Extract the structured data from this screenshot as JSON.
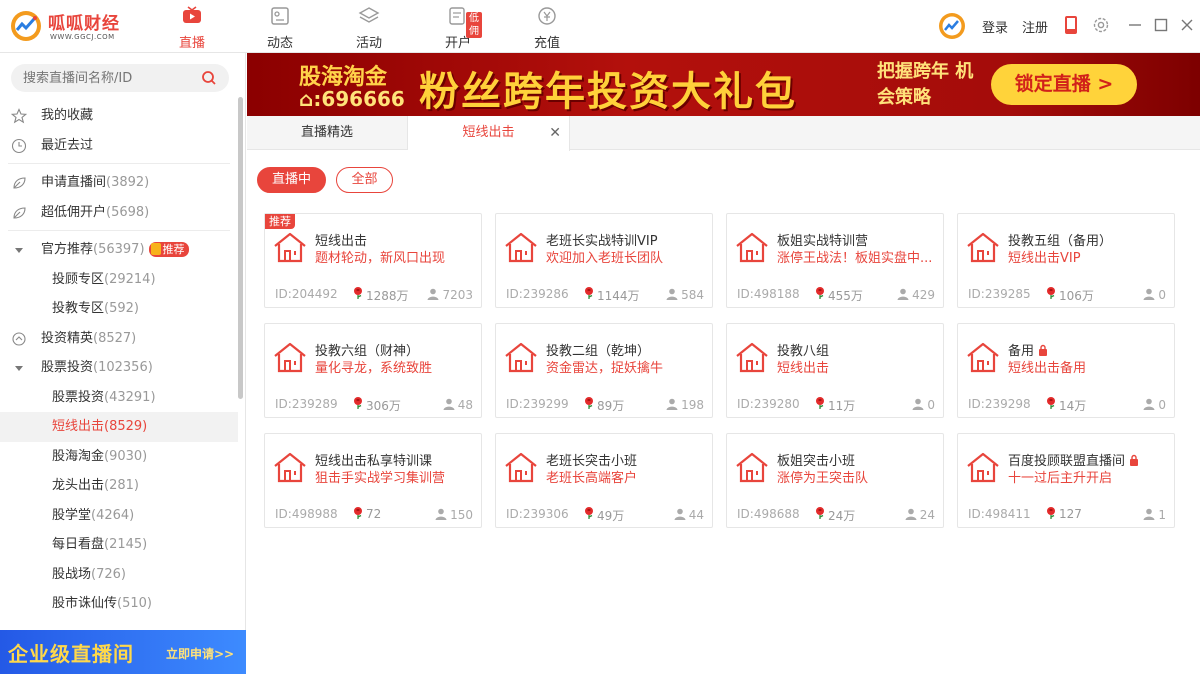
{
  "app": {
    "name": "呱呱财经",
    "url": "WWW.GGCJ.COM"
  },
  "nav": [
    {
      "label": "直播",
      "active": true
    },
    {
      "label": "动态"
    },
    {
      "label": "活动"
    },
    {
      "label": "开户",
      "badge": "低佣"
    },
    {
      "label": "充值"
    }
  ],
  "user": {
    "login": "登录",
    "register": "注册"
  },
  "search": {
    "placeholder": "搜索直播间名称/ID"
  },
  "sidebar": {
    "top": [
      {
        "label": "我的收藏",
        "icon": "star-icon"
      },
      {
        "label": "最近去过",
        "icon": "clock-icon"
      }
    ],
    "groups": [
      {
        "label": "申请直播间",
        "count": "(3892)",
        "icon": "leaf-icon"
      },
      {
        "label": "超低佣开户",
        "count": "(5698)",
        "icon": "leaf-icon"
      },
      {
        "label": "官方推荐",
        "count": "(56397)",
        "icon": "triangle-icon",
        "tag": "推荐"
      },
      {
        "label": "投顾专区",
        "count": "(29214)",
        "sub": true
      },
      {
        "label": "投教专区",
        "count": "(592)",
        "sub": true
      },
      {
        "label": "投资精英",
        "count": "(8527)",
        "icon": "coin-icon"
      },
      {
        "label": "股票投资",
        "count": "(102356)",
        "icon": "triangle-icon"
      },
      {
        "label": "股票投资",
        "count": "(43291)",
        "sub": true
      },
      {
        "label": "短线出击",
        "count": "(8529)",
        "sub": true,
        "selected": true
      },
      {
        "label": "股海淘金",
        "count": "(9030)",
        "sub": true
      },
      {
        "label": "龙头出击",
        "count": "(281)",
        "sub": true
      },
      {
        "label": "股学堂",
        "count": "(4264)",
        "sub": true
      },
      {
        "label": "每日看盘",
        "count": "(2145)",
        "sub": true
      },
      {
        "label": "股战场",
        "count": "(726)",
        "sub": true
      },
      {
        "label": "股市诛仙传",
        "count": "(510)",
        "sub": true
      }
    ],
    "promo": {
      "title": "企业级直播间",
      "cta": "立即申请>>"
    }
  },
  "banner": {
    "brand": "股海淘金",
    "room": "⌂:696666",
    "headline": "粉丝跨年投资大礼包",
    "slogan": "把握跨年 机会策略",
    "cta": "锁定直播 >"
  },
  "tabs": [
    {
      "label": "直播精选"
    },
    {
      "label": "短线出击",
      "active": true,
      "closable": true
    }
  ],
  "filters": {
    "live": "直播中",
    "all": "全部"
  },
  "cards": [
    {
      "title": "短线出击",
      "desc": "题材轮动，新风口出现",
      "id": "ID:204492",
      "roses": "1288万",
      "viewers": "7203",
      "tag": "推荐"
    },
    {
      "title": "老班长实战特训VIP",
      "desc": "欢迎加入老班长团队",
      "id": "ID:239286",
      "roses": "1144万",
      "viewers": "584"
    },
    {
      "title": "板姐实战特训营",
      "desc": "涨停王战法！板姐实盘中...",
      "id": "ID:498188",
      "roses": "455万",
      "viewers": "429"
    },
    {
      "title": "投教五组（备用）",
      "desc": "短线出击VIP",
      "id": "ID:239285",
      "roses": "106万",
      "viewers": "0"
    },
    {
      "title": "投教六组（财神）",
      "desc": "量化寻龙，系统致胜",
      "id": "ID:239289",
      "roses": "306万",
      "viewers": "48"
    },
    {
      "title": "投教二组（乾坤）",
      "desc": "资金雷达，捉妖擒牛",
      "id": "ID:239299",
      "roses": "89万",
      "viewers": "198"
    },
    {
      "title": "投教八组",
      "desc": "短线出击",
      "id": "ID:239280",
      "roses": "11万",
      "viewers": "0"
    },
    {
      "title": "备用",
      "desc": "短线出击备用",
      "id": "ID:239298",
      "roses": "14万",
      "viewers": "0",
      "locked": true
    },
    {
      "title": "短线出击私享特训课",
      "desc": "狙击手实战学习集训营",
      "id": "ID:498988",
      "roses": "72",
      "viewers": "150"
    },
    {
      "title": "老班长突击小班",
      "desc": "老班长高端客户",
      "id": "ID:239306",
      "roses": "49万",
      "viewers": "44"
    },
    {
      "title": "板姐突击小班",
      "desc": "涨停为王突击队",
      "id": "ID:498688",
      "roses": "24万",
      "viewers": "24"
    },
    {
      "title": "百度投顾联盟直播间",
      "desc": "十一过后主升开启",
      "id": "ID:498411",
      "roses": "127",
      "viewers": "1",
      "locked": true
    }
  ],
  "colors": {
    "accent": "#e8453c",
    "banner": "#b3100c",
    "gold": "#ffd13a"
  }
}
